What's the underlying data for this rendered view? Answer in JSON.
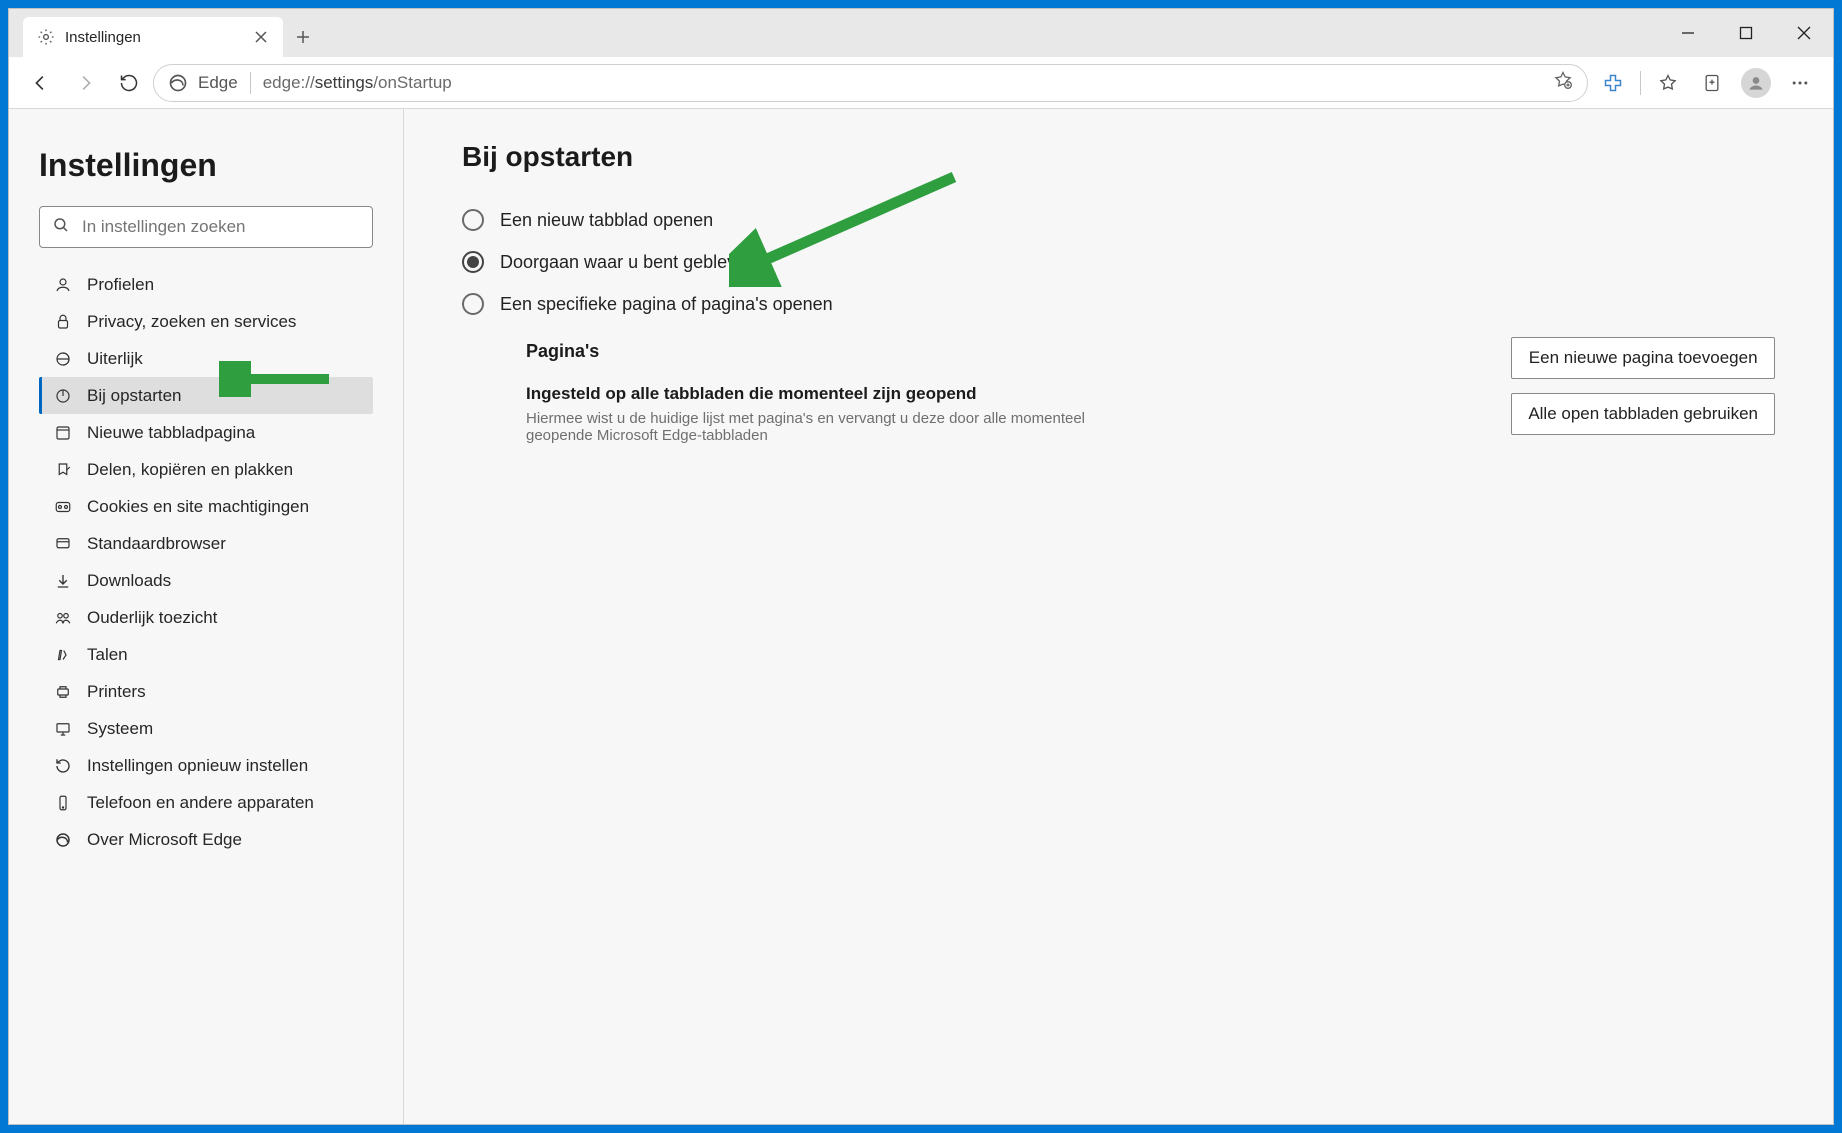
{
  "tab": {
    "title": "Instellingen"
  },
  "address": {
    "edge_label": "Edge",
    "url_prefix": "edge://",
    "url_bold": "settings",
    "url_suffix": "/onStartup"
  },
  "sidebar": {
    "title": "Instellingen",
    "search_placeholder": "In instellingen zoeken",
    "items": [
      {
        "label": "Profielen"
      },
      {
        "label": "Privacy, zoeken en services"
      },
      {
        "label": "Uiterlijk"
      },
      {
        "label": "Bij opstarten"
      },
      {
        "label": "Nieuwe tabbladpagina"
      },
      {
        "label": "Delen, kopiëren en plakken"
      },
      {
        "label": "Cookies en site machtigingen"
      },
      {
        "label": "Standaardbrowser"
      },
      {
        "label": "Downloads"
      },
      {
        "label": "Ouderlijk toezicht"
      },
      {
        "label": "Talen"
      },
      {
        "label": "Printers"
      },
      {
        "label": "Systeem"
      },
      {
        "label": "Instellingen opnieuw instellen"
      },
      {
        "label": "Telefoon en andere apparaten"
      },
      {
        "label": "Over Microsoft Edge"
      }
    ],
    "active_index": 3
  },
  "main": {
    "heading": "Bij opstarten",
    "options": [
      {
        "label": "Een nieuw tabblad openen"
      },
      {
        "label": "Doorgaan waar u bent gebleven"
      },
      {
        "label": "Een specifieke pagina of pagina's openen"
      }
    ],
    "selected_index": 1,
    "pages_heading": "Pagina's",
    "subtitle": "Ingesteld op alle tabbladen die momenteel zijn geopend",
    "subtext": "Hiermee wist u de huidige lijst met pagina's en vervangt u deze door alle momenteel geopende Microsoft Edge-tabbladen",
    "btn_add": "Een nieuwe pagina toevoegen",
    "btn_use_all": "Alle open tabbladen gebruiken"
  }
}
